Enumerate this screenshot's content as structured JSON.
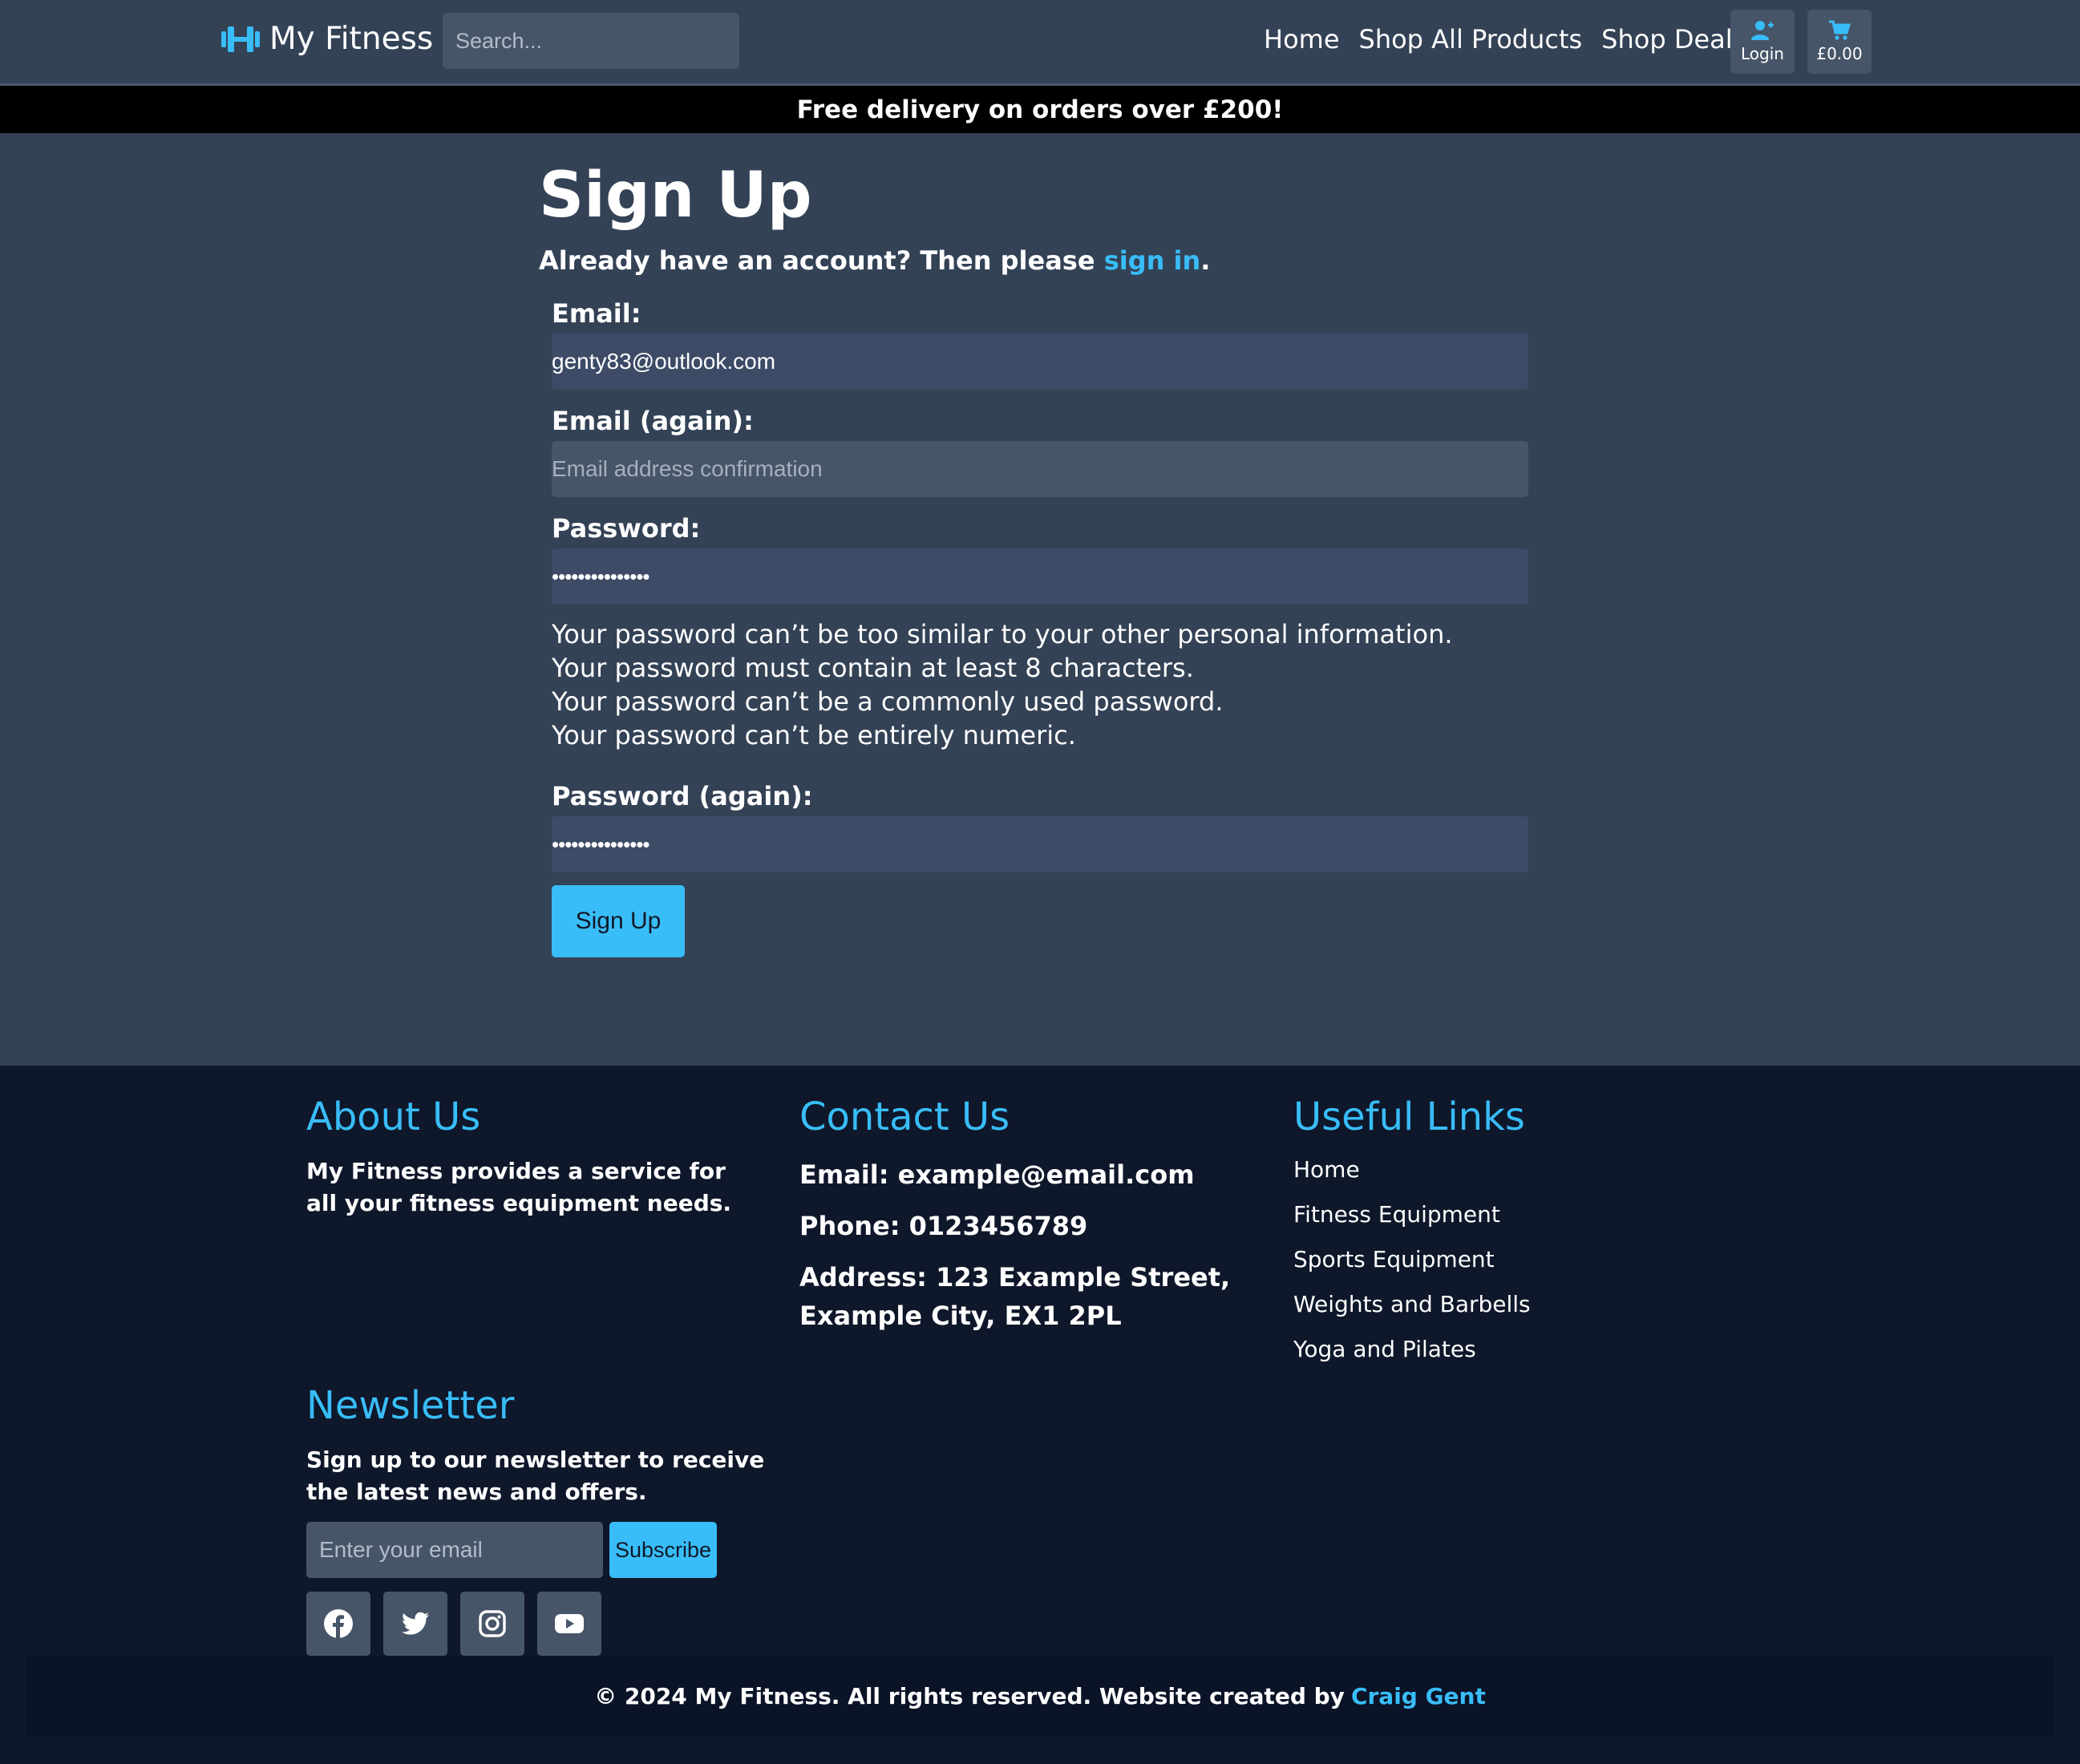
{
  "header": {
    "brand": "My Fitness",
    "search_placeholder": "Search...",
    "nav": [
      "Home",
      "Shop All Products",
      "Shop Deals"
    ],
    "login_label": "Login",
    "cart_total": "£0.00"
  },
  "banner": "Free delivery on orders over £200!",
  "signup": {
    "title": "Sign Up",
    "already_text": "Already have an account? Then please ",
    "sign_in_link": "sign in",
    "period": ".",
    "email_label": "Email:",
    "email_value": "genty83@outlook.com",
    "email_again_label": "Email (again):",
    "email_again_placeholder": "Email address confirmation",
    "password_label": "Password:",
    "password_value": "•••••••••••••••",
    "help": [
      "Your password can’t be too similar to your other personal information.",
      "Your password must contain at least 8 characters.",
      "Your password can’t be a commonly used password.",
      "Your password can’t be entirely numeric."
    ],
    "password_again_label": "Password (again):",
    "password_again_value": "•••••••••••••••",
    "submit_label": "Sign Up"
  },
  "footer": {
    "about_title": "About Us",
    "about_text": "My Fitness provides a service for all your fitness equipment needs.",
    "contact_title": "Contact Us",
    "contact_email": "Email: example@email.com",
    "contact_phone": "Phone: 0123456789",
    "contact_address": "Address: 123 Example Street, Example City, EX1 2PL",
    "links_title": "Useful Links",
    "links": [
      "Home",
      "Fitness Equipment",
      "Sports Equipment",
      "Weights and Barbells",
      "Yoga and Pilates"
    ],
    "newsletter_title": "Newsletter",
    "newsletter_text": "Sign up to our newsletter to receive the latest news and offers.",
    "newsletter_placeholder": "Enter your email",
    "subscribe_label": "Subscribe",
    "social": [
      "facebook-icon",
      "twitter-icon",
      "instagram-icon",
      "youtube-icon"
    ],
    "copyright": "© 2024 My Fitness. All rights reserved.  Website created by",
    "author": "Craig Gent"
  },
  "colors": {
    "accent": "#38bdf8",
    "page_bg": "#344256",
    "footer_bg": "#0f172a",
    "input_bg": "#3d4b66"
  }
}
